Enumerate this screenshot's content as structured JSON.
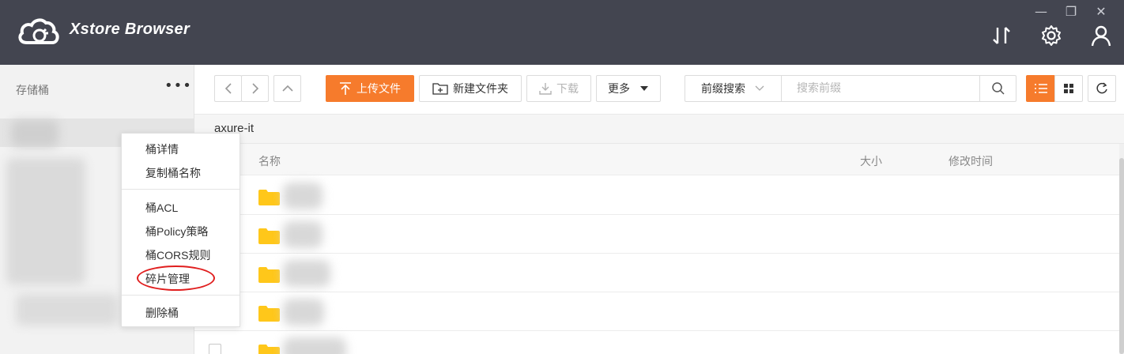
{
  "app": {
    "title": "Xstore Browser",
    "window_controls": {
      "minimize": "—",
      "restore": "❐",
      "close": "✕"
    },
    "header_icons": [
      "transfer-icon",
      "gear-icon",
      "user-icon"
    ]
  },
  "sidebar": {
    "title": "存储桶",
    "more": "•••"
  },
  "context_menu": {
    "items": [
      "桶详情",
      "复制桶名称",
      "桶ACL",
      "桶Policy策略",
      "桶CORS规则",
      "碎片管理",
      "删除桶"
    ],
    "highlighted": "碎片管理",
    "highlight_color": "#e01e1e"
  },
  "toolbar": {
    "upload": "上传文件",
    "new_folder": "新建文件夹",
    "download": "下载",
    "more": "更多",
    "search_type": "前缀搜索",
    "search_placeholder": "搜索前缀",
    "accent_color": "#f67b2c"
  },
  "path": "axure-it",
  "table": {
    "columns": {
      "name": "名称",
      "size": "大小",
      "modified": "修改时间"
    },
    "rows": [
      {
        "type": "folder"
      },
      {
        "type": "folder"
      },
      {
        "type": "folder"
      },
      {
        "type": "folder"
      },
      {
        "type": "folder"
      }
    ]
  }
}
